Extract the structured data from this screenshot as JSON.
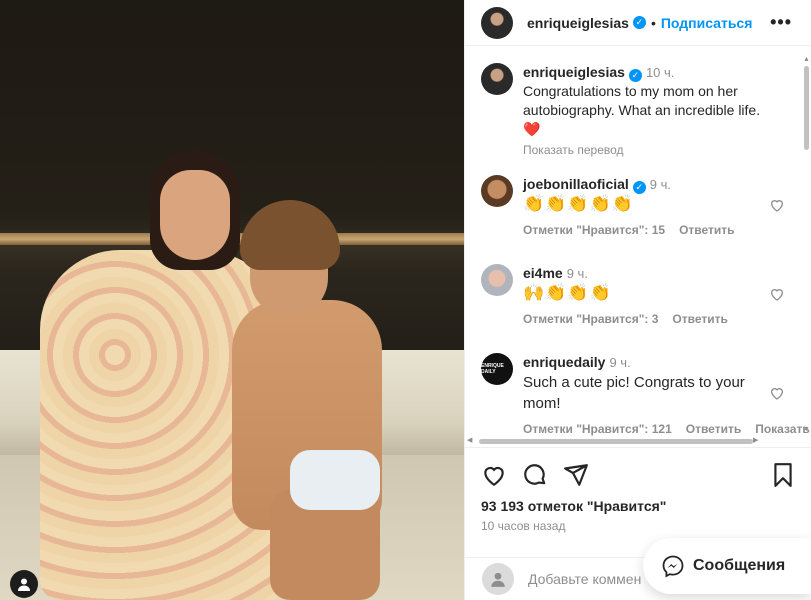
{
  "header": {
    "username": "enriqueiglesias",
    "separator": "•",
    "follow_label": "Подписаться",
    "more_label": "•••"
  },
  "caption": {
    "username": "enriqueiglesias",
    "time": "10 ч.",
    "text": "Congratulations to my mom on her autobiography.  What an incredible life.",
    "emoji": "❤️",
    "translate_label": "Показать перевод"
  },
  "comments": [
    {
      "username": "joebonillaoficial",
      "verified": true,
      "time": "9 ч.",
      "text": "👏👏👏👏👏",
      "likes_label": "Отметки \"Нравится\": 15",
      "reply_label": "Ответить",
      "translate_label": ""
    },
    {
      "username": "ei4me",
      "verified": false,
      "time": "9 ч.",
      "text": "🙌👏👏👏",
      "likes_label": "Отметки \"Нравится\": 3",
      "reply_label": "Ответить",
      "translate_label": ""
    },
    {
      "username": "enriquedaily",
      "verified": false,
      "time": "9 ч.",
      "text": "Such a cute pic! Congrats to your mom!",
      "likes_label": "Отметки \"Нравится\": 121",
      "reply_label": "Ответить",
      "translate_label": "Показать",
      "avatar_text": "ENRIQUE DAILY"
    }
  ],
  "likes_text": "93 193 отметок \"Нравится\"",
  "time_ago": "10 часов назад",
  "add_comment_placeholder": "Добавьте коммен",
  "messages_label": "Сообщения",
  "colors": {
    "accent": "#0095f6",
    "heart": "#ed4956",
    "muted": "#8e8e8e"
  },
  "icons": [
    "heart-icon",
    "comment-icon",
    "share-icon",
    "bookmark-icon",
    "messenger-icon",
    "verified-icon",
    "user-tag-icon"
  ]
}
